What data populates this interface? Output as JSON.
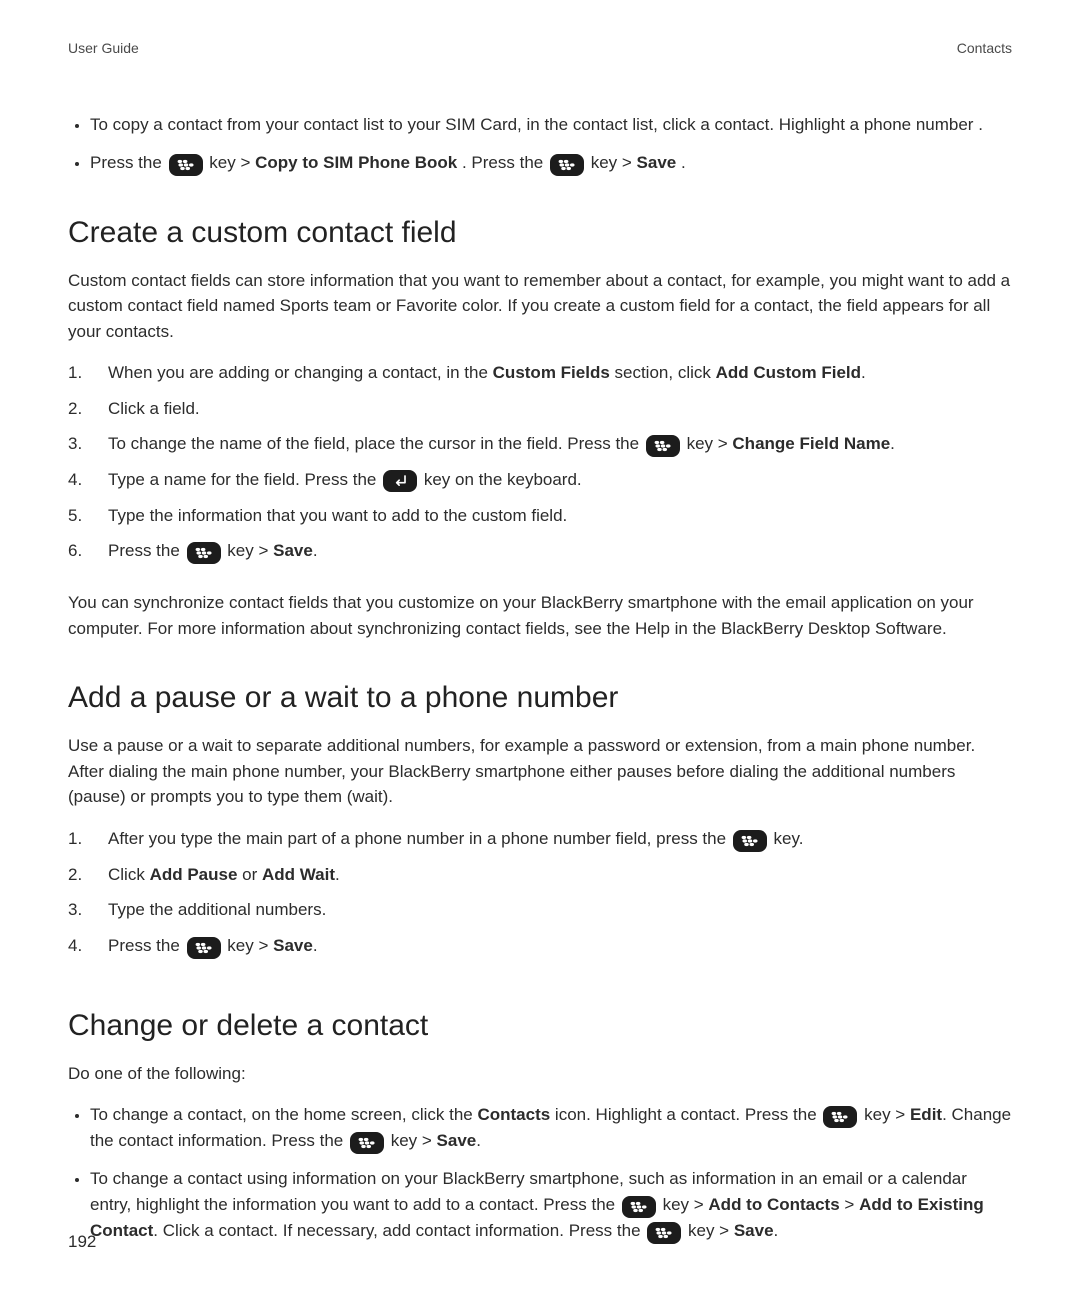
{
  "header": {
    "left": "User Guide",
    "right": "Contacts"
  },
  "page_number": "192",
  "labels": {
    "press_the": "Press the ",
    "key_gt": " key > ",
    "key": " key",
    "key_period": " key.",
    "key_on_keyboard": " key on the keyboard.",
    "gt": " > "
  },
  "intro_bullets": {
    "items": [
      {
        "text": "To copy a contact from your contact list to your SIM Card, in the contact list, click a contact. Highlight a phone number ."
      },
      {
        "parts": {
          "p1": "Press the ",
          "action1": "Copy to SIM Phone Book",
          "p2": ". Press the ",
          "action2": "Save",
          "p3": "."
        }
      }
    ]
  },
  "section1": {
    "title": "Create a custom contact field",
    "intro": "Custom contact fields can store information that you want to remember about a contact, for example, you might want to add a custom contact field named Sports team or Favorite color. If you create a custom field for a contact, the field appears for all your contacts.",
    "steps": [
      {
        "n": "1.",
        "pre": "When you are adding or changing a contact, in the ",
        "bold1": "Custom Fields",
        "mid": " section, click ",
        "bold2": "Add Custom Field",
        "post": "."
      },
      {
        "n": "2.",
        "text": "Click a field."
      },
      {
        "n": "3.",
        "pre": "To change the name of the field, place the cursor in the field. Press the ",
        "bold1": "Change Field Name",
        "post": "."
      },
      {
        "n": "4.",
        "pre": "Type a name for the field. Press the "
      },
      {
        "n": "5.",
        "text": "Type the information that you want to add to the custom field."
      },
      {
        "n": "6.",
        "bold1": "Save",
        "post": "."
      }
    ],
    "outro": "You can synchronize contact fields that you customize on your BlackBerry smartphone with the email application on your computer. For more information about synchronizing contact fields, see the Help in the BlackBerry Desktop Software."
  },
  "section2": {
    "title": "Add a pause or a wait to a phone number",
    "intro": "Use a pause or a wait to separate additional numbers, for example a password or extension, from a main phone number. After dialing the main phone number, your BlackBerry smartphone either pauses before dialing the additional numbers (pause) or prompts you to type them (wait).",
    "steps": [
      {
        "n": "1.",
        "pre": "After you type the main part of a phone number in a phone number field, press the "
      },
      {
        "n": "2.",
        "pre": "Click ",
        "bold1": "Add Pause",
        "mid": " or ",
        "bold2": "Add Wait",
        "post": "."
      },
      {
        "n": "3.",
        "text": "Type the additional numbers."
      },
      {
        "n": "4.",
        "bold1": "Save",
        "post": "."
      }
    ]
  },
  "section3": {
    "title": "Change or delete a contact",
    "intro": "Do one of the following:",
    "bullets": [
      {
        "p1": "To change a contact, on the home screen, click the ",
        "b1": "Contacts",
        "p2": " icon. Highlight a contact. Press the ",
        "b2": "Edit",
        "p3": ". Change the contact information. Press the ",
        "b3": "Save",
        "p4": "."
      },
      {
        "p1": "To change a contact using information on your BlackBerry smartphone, such as information in an email or a calendar entry, highlight the information you want to add to a contact. Press the ",
        "b1": "Add to Contacts",
        "b2": "Add to Existing Contact",
        "p2": ". Click a contact. If necessary, add contact information. Press the ",
        "b3": "Save",
        "p3": "."
      }
    ]
  }
}
